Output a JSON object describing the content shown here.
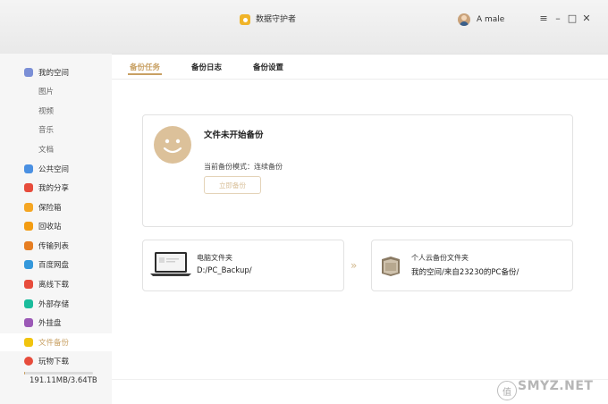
{
  "titlebar": {
    "app_title": "数据守护者",
    "user_name": "A male",
    "menu_icon": "≡",
    "minimize_icon": "–",
    "maximize_icon": "□",
    "close_icon": "✕"
  },
  "sidebar": {
    "items": [
      {
        "label": "我的空间",
        "icon": "folder-icon",
        "color": "#7b8fd6"
      },
      {
        "label": "图片"
      },
      {
        "label": "视频"
      },
      {
        "label": "音乐"
      },
      {
        "label": "文档"
      },
      {
        "label": "公共空间",
        "icon": "paper-plane-icon",
        "color": "#4a90e2"
      },
      {
        "label": "我的分享",
        "icon": "share-icon",
        "color": "#e74c3c"
      },
      {
        "label": "保险箱",
        "icon": "safe-icon",
        "color": "#f5a623"
      },
      {
        "label": "回收站",
        "icon": "trash-icon",
        "color": "#f39c12"
      },
      {
        "label": "传输列表",
        "icon": "transfer-icon",
        "color": "#e67e22"
      },
      {
        "label": "百度网盘",
        "icon": "cloud-icon",
        "color": "#3498db"
      },
      {
        "label": "离线下载",
        "icon": "download-icon",
        "color": "#e74c3c"
      },
      {
        "label": "外部存储",
        "icon": "usb-icon",
        "color": "#1abc9c"
      },
      {
        "label": "外挂盘",
        "icon": "disk-icon",
        "color": "#9b59b6"
      },
      {
        "label": "文件备份",
        "icon": "backup-icon",
        "color": "#f1c40f"
      },
      {
        "label": "玩物下载",
        "icon": "download-icon",
        "color": "#e74c3c"
      }
    ],
    "storage_text": "191.11MB/3.64TB",
    "storage_used_fraction": 0.0001
  },
  "tabs": {
    "backup_tasks": "备份任务",
    "backup_log": "备份日志",
    "backup_settings": "备份设置"
  },
  "status": {
    "title": "文件未开始备份",
    "mode": "当前备份模式：连续备份",
    "start_button": "立即备份"
  },
  "source": {
    "label": "电脑文件夹",
    "path": "D:/PC_Backup/"
  },
  "target": {
    "label": "个人云备份文件夹",
    "path": "我的空间/来自23230的PC备份/"
  },
  "arrow": "»",
  "watermark": {
    "badge": "值",
    "text": "SMYZ.NET"
  },
  "colors": {
    "accent": "#c8a063",
    "sidebar_bg": "#f6f6f6"
  }
}
